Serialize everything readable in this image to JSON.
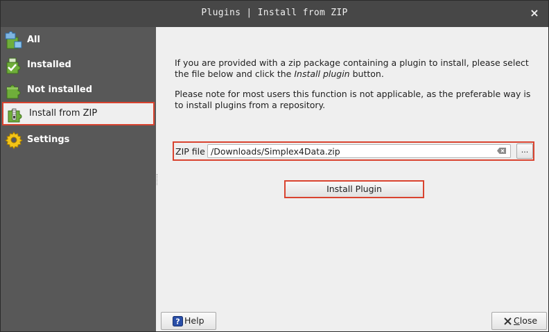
{
  "window": {
    "title": "Plugins | Install from ZIP",
    "close_glyph": "×"
  },
  "sidebar": {
    "items": [
      {
        "label": "All",
        "icon": "puzzle-all-icon"
      },
      {
        "label": "Installed",
        "icon": "puzzle-installed-icon"
      },
      {
        "label": "Not installed",
        "icon": "puzzle-not-installed-icon"
      },
      {
        "label": "Install from ZIP",
        "icon": "puzzle-zip-icon",
        "selected": true
      },
      {
        "label": "Settings",
        "icon": "gear-icon"
      }
    ]
  },
  "main": {
    "intro_text_1": "If you are provided with a zip package containing a plugin to install, please select the file below and click the",
    "intro_emphasis": "Install plugin",
    "intro_text_2": "button.",
    "note_text": "Please note for most users this function is not applicable, as the preferable way is to install plugins from a repository.",
    "zip_label": "ZIP file",
    "zip_value": "/Downloads/Simplex4Data.zip",
    "browse_label": "...",
    "install_label": "Install Plugin"
  },
  "footer": {
    "help_label": "Help",
    "close_label_first": "C",
    "close_label_rest": "lose"
  },
  "colors": {
    "highlight": "#d9432f",
    "sidebar_bg": "#585858",
    "titlebar_bg": "#474747",
    "content_bg": "#efefef"
  }
}
